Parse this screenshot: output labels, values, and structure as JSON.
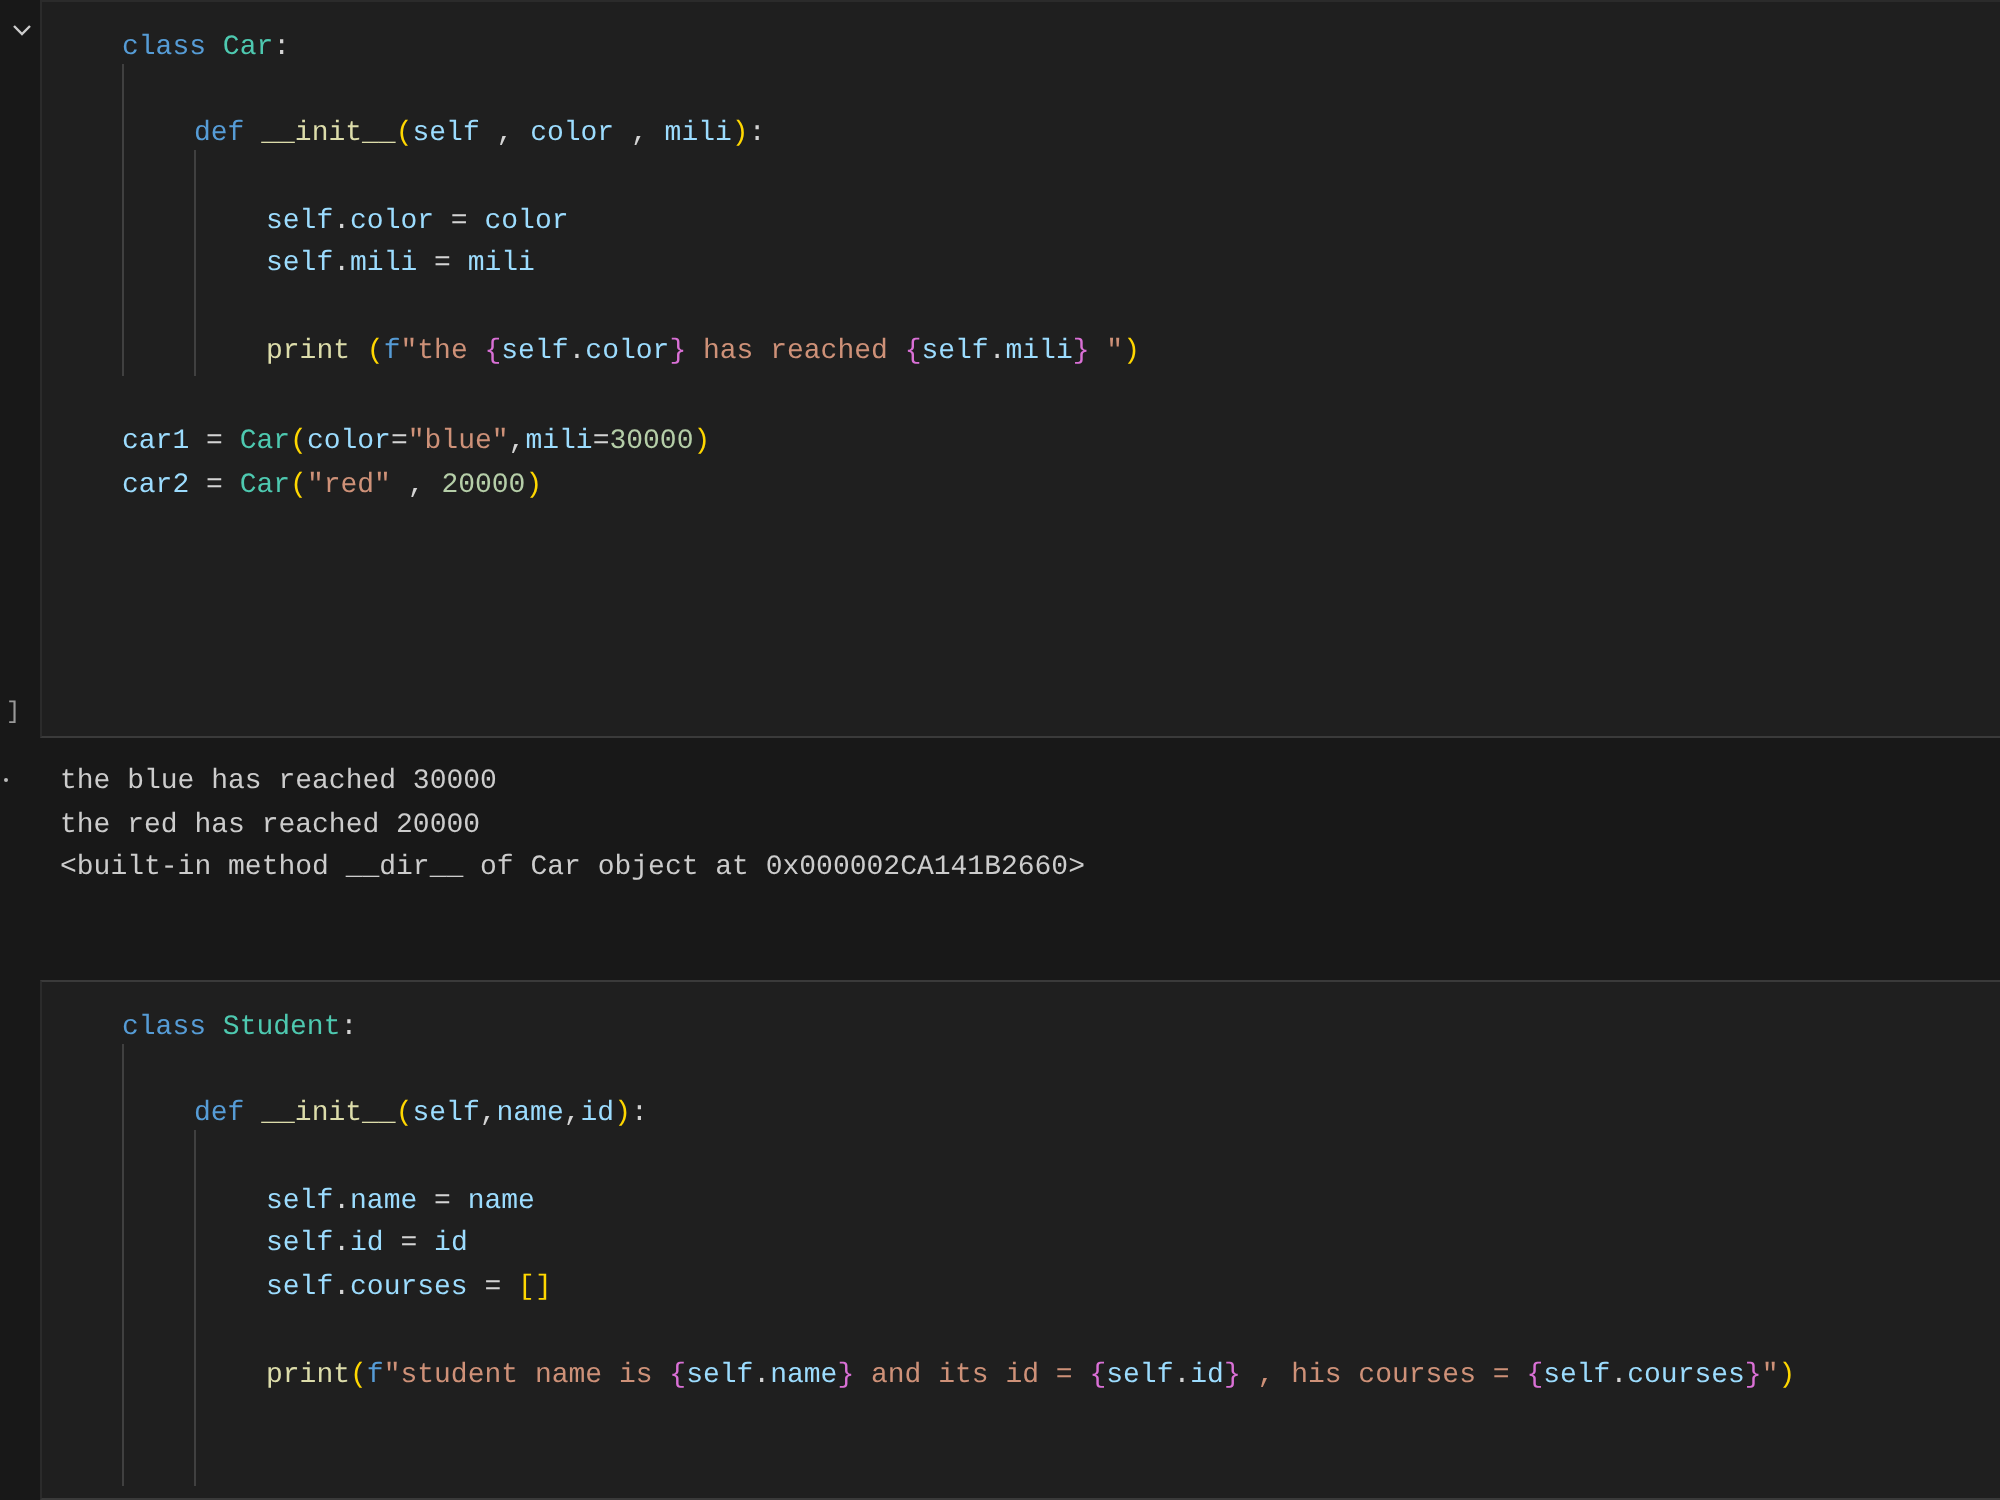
{
  "cells": [
    {
      "kind": "code",
      "collapse": true,
      "exec_count": "]",
      "lines": [
        {
          "kind": "code",
          "tokens": [
            {
              "text": "class ",
              "kind": "kw"
            },
            {
              "text": "Car",
              "kind": "cls"
            },
            {
              "text": ":",
              "kind": "op"
            }
          ],
          "children": [
            {
              "kind": "blank"
            },
            {
              "kind": "code",
              "tokens": [
                {
                  "text": "def ",
                  "kind": "kw"
                },
                {
                  "text": "__init__",
                  "kind": "fn"
                },
                {
                  "text": "(",
                  "kind": "p1"
                },
                {
                  "text": "self",
                  "kind": "var"
                },
                {
                  "text": " , ",
                  "kind": "op"
                },
                {
                  "text": "color",
                  "kind": "var"
                },
                {
                  "text": " , ",
                  "kind": "op"
                },
                {
                  "text": "mili",
                  "kind": "var"
                },
                {
                  "text": ")",
                  "kind": "p1"
                },
                {
                  "text": ":",
                  "kind": "op"
                }
              ],
              "children": [
                {
                  "kind": "blank"
                },
                {
                  "kind": "code",
                  "tokens": [
                    {
                      "text": "self",
                      "kind": "var"
                    },
                    {
                      "text": ".",
                      "kind": "op"
                    },
                    {
                      "text": "color",
                      "kind": "var"
                    },
                    {
                      "text": " = ",
                      "kind": "op"
                    },
                    {
                      "text": "color",
                      "kind": "var"
                    }
                  ]
                },
                {
                  "kind": "code",
                  "tokens": [
                    {
                      "text": "self",
                      "kind": "var"
                    },
                    {
                      "text": ".",
                      "kind": "op"
                    },
                    {
                      "text": "mili",
                      "kind": "var"
                    },
                    {
                      "text": " = ",
                      "kind": "op"
                    },
                    {
                      "text": "mili",
                      "kind": "var"
                    }
                  ]
                },
                {
                  "kind": "blank"
                },
                {
                  "kind": "code",
                  "tokens": [
                    {
                      "text": "print ",
                      "kind": "fn"
                    },
                    {
                      "text": "(",
                      "kind": "p1"
                    },
                    {
                      "text": "f",
                      "kind": "kw"
                    },
                    {
                      "text": "\"the ",
                      "kind": "str"
                    },
                    {
                      "text": "{",
                      "kind": "p2"
                    },
                    {
                      "text": "self",
                      "kind": "var"
                    },
                    {
                      "text": ".",
                      "kind": "op"
                    },
                    {
                      "text": "color",
                      "kind": "var"
                    },
                    {
                      "text": "}",
                      "kind": "p2"
                    },
                    {
                      "text": " has reached ",
                      "kind": "str"
                    },
                    {
                      "text": "{",
                      "kind": "p2"
                    },
                    {
                      "text": "self",
                      "kind": "var"
                    },
                    {
                      "text": ".",
                      "kind": "op"
                    },
                    {
                      "text": "mili",
                      "kind": "var"
                    },
                    {
                      "text": "}",
                      "kind": "p2"
                    },
                    {
                      "text": " \"",
                      "kind": "str"
                    },
                    {
                      "text": ")",
                      "kind": "p1"
                    }
                  ]
                }
              ]
            }
          ]
        },
        {
          "kind": "blank"
        },
        {
          "kind": "code",
          "tokens": [
            {
              "text": "car1",
              "kind": "var"
            },
            {
              "text": " = ",
              "kind": "op"
            },
            {
              "text": "Car",
              "kind": "cls"
            },
            {
              "text": "(",
              "kind": "p1"
            },
            {
              "text": "color",
              "kind": "var"
            },
            {
              "text": "=",
              "kind": "op"
            },
            {
              "text": "\"blue\"",
              "kind": "str"
            },
            {
              "text": ",",
              "kind": "op"
            },
            {
              "text": "mili",
              "kind": "var"
            },
            {
              "text": "=",
              "kind": "op"
            },
            {
              "text": "30000",
              "kind": "num"
            },
            {
              "text": ")",
              "kind": "p1"
            }
          ]
        },
        {
          "kind": "code",
          "tokens": [
            {
              "text": "car2",
              "kind": "var"
            },
            {
              "text": " = ",
              "kind": "op"
            },
            {
              "text": "Car",
              "kind": "cls"
            },
            {
              "text": "(",
              "kind": "p1"
            },
            {
              "text": "\"red\"",
              "kind": "str"
            },
            {
              "text": " , ",
              "kind": "op"
            },
            {
              "text": "20000",
              "kind": "num"
            },
            {
              "text": ")",
              "kind": "p1"
            }
          ]
        }
      ],
      "output": [
        "the blue has reached 30000",
        "the red has reached 20000",
        "<built-in method __dir__ of Car object at 0x000002CA141B2660>"
      ]
    },
    {
      "kind": "code",
      "collapse": false,
      "lines": [
        {
          "kind": "code",
          "tokens": [
            {
              "text": "class ",
              "kind": "kw"
            },
            {
              "text": "Student",
              "kind": "cls"
            },
            {
              "text": ":",
              "kind": "op"
            }
          ],
          "children": [
            {
              "kind": "blank"
            },
            {
              "kind": "code",
              "tokens": [
                {
                  "text": "def ",
                  "kind": "kw"
                },
                {
                  "text": "__init__",
                  "kind": "fn"
                },
                {
                  "text": "(",
                  "kind": "p1"
                },
                {
                  "text": "self",
                  "kind": "var"
                },
                {
                  "text": ",",
                  "kind": "op"
                },
                {
                  "text": "name",
                  "kind": "var"
                },
                {
                  "text": ",",
                  "kind": "op"
                },
                {
                  "text": "id",
                  "kind": "var"
                },
                {
                  "text": ")",
                  "kind": "p1"
                },
                {
                  "text": ":",
                  "kind": "op"
                }
              ],
              "children": [
                {
                  "kind": "blank"
                },
                {
                  "kind": "code",
                  "tokens": [
                    {
                      "text": "self",
                      "kind": "var"
                    },
                    {
                      "text": ".",
                      "kind": "op"
                    },
                    {
                      "text": "name",
                      "kind": "var"
                    },
                    {
                      "text": " = ",
                      "kind": "op"
                    },
                    {
                      "text": "name",
                      "kind": "var"
                    }
                  ]
                },
                {
                  "kind": "code",
                  "tokens": [
                    {
                      "text": "self",
                      "kind": "var"
                    },
                    {
                      "text": ".",
                      "kind": "op"
                    },
                    {
                      "text": "id",
                      "kind": "var"
                    },
                    {
                      "text": " = ",
                      "kind": "op"
                    },
                    {
                      "text": "id",
                      "kind": "var"
                    }
                  ]
                },
                {
                  "kind": "code",
                  "tokens": [
                    {
                      "text": "self",
                      "kind": "var"
                    },
                    {
                      "text": ".",
                      "kind": "op"
                    },
                    {
                      "text": "courses",
                      "kind": "var"
                    },
                    {
                      "text": " = ",
                      "kind": "op"
                    },
                    {
                      "text": "[]",
                      "kind": "p1"
                    }
                  ]
                },
                {
                  "kind": "blank"
                },
                {
                  "kind": "code",
                  "tokens": [
                    {
                      "text": "print",
                      "kind": "fn"
                    },
                    {
                      "text": "(",
                      "kind": "p1"
                    },
                    {
                      "text": "f",
                      "kind": "kw"
                    },
                    {
                      "text": "\"student name is ",
                      "kind": "str"
                    },
                    {
                      "text": "{",
                      "kind": "p2"
                    },
                    {
                      "text": "self",
                      "kind": "var"
                    },
                    {
                      "text": ".",
                      "kind": "op"
                    },
                    {
                      "text": "name",
                      "kind": "var"
                    },
                    {
                      "text": "}",
                      "kind": "p2"
                    },
                    {
                      "text": " and its id = ",
                      "kind": "str"
                    },
                    {
                      "text": "{",
                      "kind": "p2"
                    },
                    {
                      "text": "self",
                      "kind": "var"
                    },
                    {
                      "text": ".",
                      "kind": "op"
                    },
                    {
                      "text": "id",
                      "kind": "var"
                    },
                    {
                      "text": "}",
                      "kind": "p2"
                    },
                    {
                      "text": " , his courses = ",
                      "kind": "str"
                    },
                    {
                      "text": "{",
                      "kind": "p2"
                    },
                    {
                      "text": "self",
                      "kind": "var"
                    },
                    {
                      "text": ".",
                      "kind": "op"
                    },
                    {
                      "text": "courses",
                      "kind": "var"
                    },
                    {
                      "text": "}",
                      "kind": "p2"
                    },
                    {
                      "text": "\"",
                      "kind": "str"
                    },
                    {
                      "text": ")",
                      "kind": "p1"
                    }
                  ]
                },
                {
                  "kind": "blank"
                },
                {
                  "kind": "blank"
                }
              ]
            }
          ]
        }
      ]
    }
  ]
}
